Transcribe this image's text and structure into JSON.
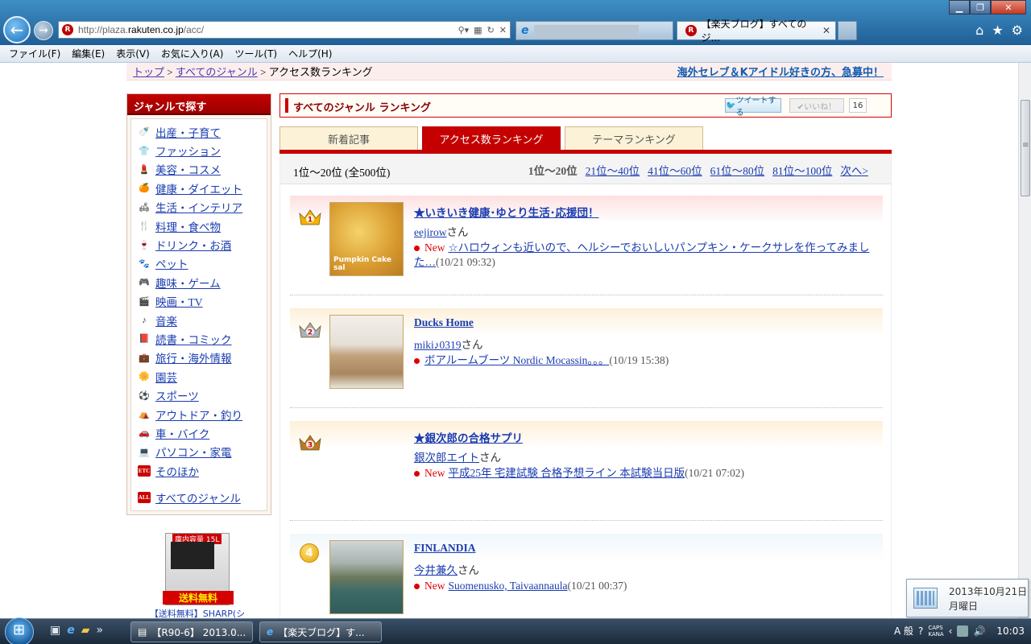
{
  "browser": {
    "address_prefix": "http://plaza.",
    "address_host": "rakuten.co.jp",
    "address_suffix": "/acc/",
    "tab_active_title": "【楽天ブログ】すべてのジ...",
    "menu": [
      "ファイル(F)",
      "編集(E)",
      "表示(V)",
      "お気に入り(A)",
      "ツール(T)",
      "ヘルプ(H)"
    ]
  },
  "breadcrumb": {
    "top": "トップ",
    "sep1": " > ",
    "all_genres": "すべてのジャンル",
    "sep2": " > ",
    "current": "アクセス数ランキング",
    "promo": "海外セレブ＆Kアイドル好きの方、急募中！"
  },
  "sidebar": {
    "heading": "ジャンルで探す",
    "items": [
      {
        "label": "出産・子育て",
        "icon": "baby-bottle-icon",
        "glyph": "🍼"
      },
      {
        "label": "ファッション",
        "icon": "shirt-icon",
        "glyph": "👕"
      },
      {
        "label": "美容・コスメ",
        "icon": "cosmetics-icon",
        "glyph": "💄"
      },
      {
        "label": "健康・ダイエット",
        "icon": "health-icon",
        "glyph": "🍊"
      },
      {
        "label": "生活・インテリア",
        "icon": "sofa-icon",
        "glyph": "🛋"
      },
      {
        "label": "料理・食べ物",
        "icon": "cutlery-icon",
        "glyph": "🍴"
      },
      {
        "label": "ドリンク・お酒",
        "icon": "wine-icon",
        "glyph": "🍷"
      },
      {
        "label": "ペット",
        "icon": "pet-icon",
        "glyph": "🐾"
      },
      {
        "label": "趣味・ゲーム",
        "icon": "game-icon",
        "glyph": "🎮"
      },
      {
        "label": "映画・TV",
        "icon": "clapboard-icon",
        "glyph": "🎬"
      },
      {
        "label": "音楽",
        "icon": "music-note-icon",
        "glyph": "♪"
      },
      {
        "label": "読書・コミック",
        "icon": "book-icon",
        "glyph": "📕"
      },
      {
        "label": "旅行・海外情報",
        "icon": "suitcase-icon",
        "glyph": "💼"
      },
      {
        "label": "園芸",
        "icon": "flower-icon",
        "glyph": "🌼"
      },
      {
        "label": "スポーツ",
        "icon": "soccer-ball-icon",
        "glyph": "⚽"
      },
      {
        "label": "アウトドア・釣り",
        "icon": "outdoor-icon",
        "glyph": "⛺"
      },
      {
        "label": "車・バイク",
        "icon": "car-icon",
        "glyph": "🚗"
      },
      {
        "label": "パソコン・家電",
        "icon": "computer-icon",
        "glyph": "💻"
      },
      {
        "label": "そのほか",
        "icon": "other-icon",
        "glyph": "ETC"
      }
    ],
    "all_label": "すべてのジャンル",
    "all_glyph": "ALL"
  },
  "ad": {
    "badge": "庫内容量 15L",
    "ribbon": "送料無料",
    "caption": "【送料無料】SHARP(シ"
  },
  "main": {
    "title": "すべてのジャンル  ランキング",
    "tweet": "ツイートする",
    "like": "✔いいね！",
    "like_count": "16",
    "tabs": [
      "新着記事",
      "アクセス数ランキング",
      "テーマランキング"
    ],
    "pager_range": "1位〜20位   (全500位)",
    "pager_current": "1位〜20位",
    "pager_links": [
      "21位〜40位",
      "41位〜60位",
      "61位〜80位",
      "81位〜100位",
      "次へ>"
    ]
  },
  "entries": [
    {
      "rank": "1",
      "title": "★いきいき健康･ゆとり生活･応援団！",
      "author": "eejirow",
      "san": "さん",
      "new": "New",
      "post_title": "☆ハロウィンも近いので、ヘルシーでおいしいパンプキン・ケークサレを作ってみました…",
      "post_date": "(10/21 09:32)",
      "has_new": true,
      "thumb_caption": "Pumpkin Cake sal",
      "bg": "#fde0e0"
    },
    {
      "rank": "2",
      "title": "Ducks Home",
      "author": "miki♪0319",
      "san": "さん",
      "new": "",
      "post_title": "ボアルームブーツ Nordic Mocassin。。。",
      "post_date": "(10/19 15:38)",
      "has_new": false,
      "thumb_caption": "",
      "bg": "#fdf0d8"
    },
    {
      "rank": "3",
      "title": "★銀次郎の合格サプリ",
      "author": "銀次郎エイト",
      "san": "さん",
      "new": "New",
      "post_title": "平成25年  宅建試験  合格予想ライン  本試験当日版",
      "post_date": "(10/21 07:02)",
      "has_new": true,
      "thumb_caption": "",
      "bg": "#fdf0d8"
    },
    {
      "rank": "4",
      "title": "FINLANDIA",
      "author": "今井兼久",
      "san": "さん",
      "new": "New",
      "post_title": "Suomenusko, Taivaannaula",
      "post_date": "(10/21 00:37)",
      "has_new": true,
      "thumb_caption": "",
      "bg": "#f0f7fb"
    }
  ],
  "taskbar": {
    "task1": "【R90-6】 2013.0...",
    "task2": "【楽天ブログ】す...",
    "ime": "A 般",
    "caps": "CAPS",
    "kana": "KANA",
    "clock": "10:03",
    "date": "2013年10月21日",
    "weekday": "月曜日"
  },
  "colors": {
    "rakuten_red": "#c40000",
    "link_blue": "#1a3cb0",
    "promo_blue": "#0f5cb0"
  }
}
